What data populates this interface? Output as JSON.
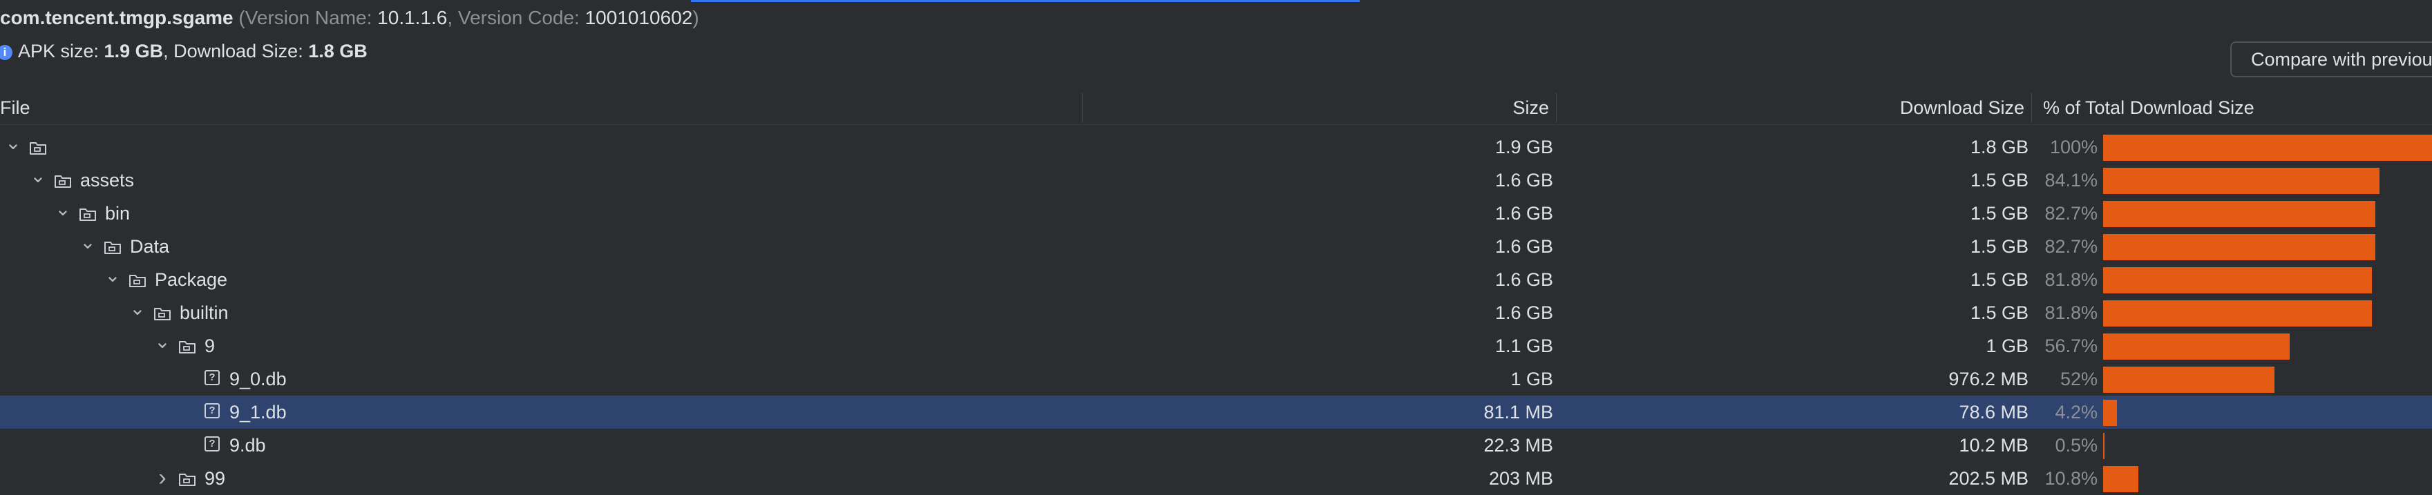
{
  "header": {
    "package": "com.tencent.tmgp.sgame",
    "version_name_label": "(Version Name: ",
    "version_name": "10.1.1.6",
    "version_code_label": ", Version Code: ",
    "version_code": "1001010602",
    "close_paren": ")"
  },
  "summary": {
    "apk_label": "APK size: ",
    "apk_size": "1.9 GB",
    "download_label": ", Download Size: ",
    "download_size": "1.8 GB"
  },
  "compare_button": "Compare with previous",
  "columns": {
    "file": "File",
    "size": "Size",
    "download_size": "Download Size",
    "percent": "% of Total Download Size"
  },
  "colors": {
    "bar": "#e55b13",
    "selection": "#2e436e",
    "accent": "#3574f0"
  },
  "rows": [
    {
      "name": "",
      "icon": "folder-icon",
      "expand": "expanded",
      "level": 0,
      "size": "1.9 GB",
      "download": "1.8 GB",
      "percent": "100%",
      "fraction": 1.0
    },
    {
      "name": "assets",
      "icon": "folder-icon",
      "expand": "expanded",
      "level": 1,
      "size": "1.6 GB",
      "download": "1.5 GB",
      "percent": "84.1%",
      "fraction": 0.841
    },
    {
      "name": "bin",
      "icon": "folder-icon",
      "expand": "expanded",
      "level": 2,
      "size": "1.6 GB",
      "download": "1.5 GB",
      "percent": "82.7%",
      "fraction": 0.827
    },
    {
      "name": "Data",
      "icon": "folder-icon",
      "expand": "expanded",
      "level": 3,
      "size": "1.6 GB",
      "download": "1.5 GB",
      "percent": "82.7%",
      "fraction": 0.827
    },
    {
      "name": "Package",
      "icon": "folder-icon",
      "expand": "expanded",
      "level": 4,
      "size": "1.6 GB",
      "download": "1.5 GB",
      "percent": "81.8%",
      "fraction": 0.818
    },
    {
      "name": "builtin",
      "icon": "folder-icon",
      "expand": "expanded",
      "level": 5,
      "size": "1.6 GB",
      "download": "1.5 GB",
      "percent": "81.8%",
      "fraction": 0.818
    },
    {
      "name": "9",
      "icon": "folder-icon",
      "expand": "expanded",
      "level": 6,
      "size": "1.1 GB",
      "download": "1 GB",
      "percent": "56.7%",
      "fraction": 0.567
    },
    {
      "name": "9_0.db",
      "icon": "unknown-file-icon",
      "expand": "none",
      "level": 7,
      "size": "1 GB",
      "download": "976.2 MB",
      "percent": "52%",
      "fraction": 0.52
    },
    {
      "name": "9_1.db",
      "icon": "unknown-file-icon",
      "expand": "none",
      "level": 7,
      "size": "81.1 MB",
      "download": "78.6 MB",
      "percent": "4.2%",
      "fraction": 0.042,
      "selected": true
    },
    {
      "name": "9.db",
      "icon": "unknown-file-icon",
      "expand": "none",
      "level": 7,
      "size": "22.3 MB",
      "download": "10.2 MB",
      "percent": "0.5%",
      "fraction": 0.005
    },
    {
      "name": "99",
      "icon": "folder-icon",
      "expand": "collapsed",
      "level": 6,
      "size": "203 MB",
      "download": "202.5 MB",
      "percent": "10.8%",
      "fraction": 0.108
    }
  ]
}
